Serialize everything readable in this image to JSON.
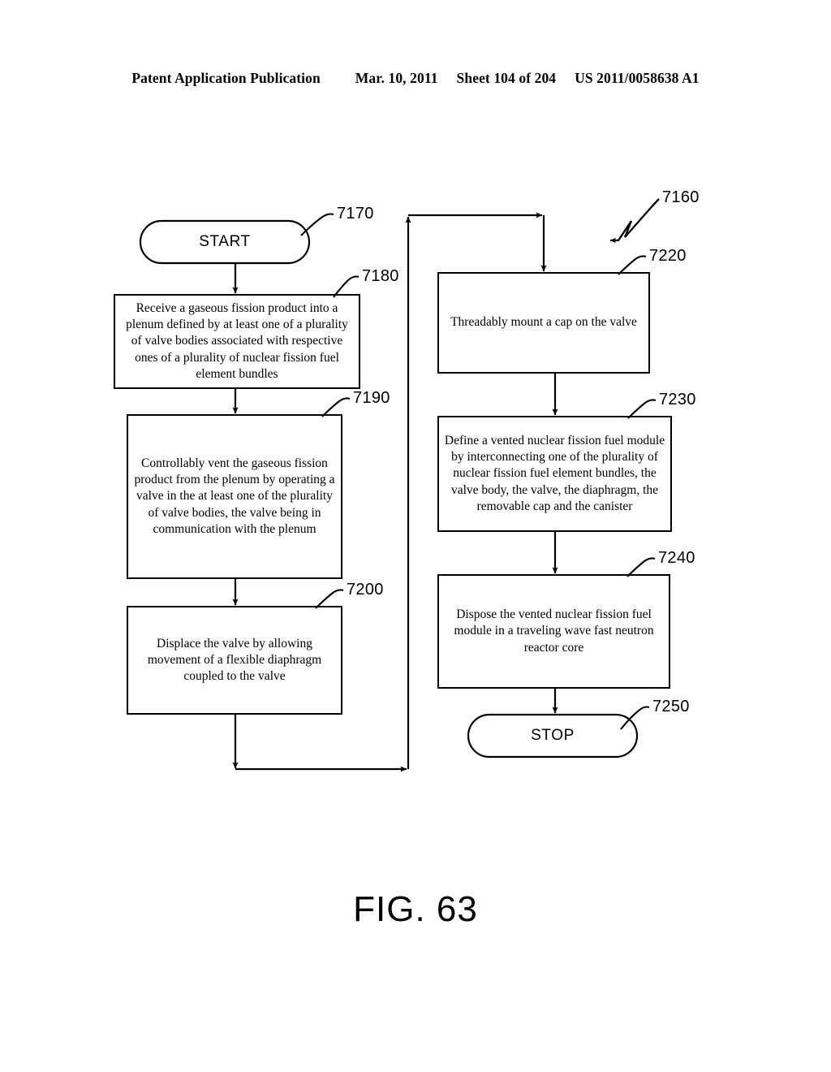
{
  "header": {
    "publication": "Patent Application Publication",
    "date": "Mar. 10, 2011",
    "sheet": "Sheet 104 of 204",
    "patent_number": "US 2011/0058638 A1"
  },
  "figure": {
    "caption": "FIG. 63",
    "diagram_ref": "7160"
  },
  "flowchart": {
    "type": "flowchart",
    "nodes": [
      {
        "id": "start",
        "ref": "7170",
        "shape": "terminal",
        "label": "START",
        "column": "left"
      },
      {
        "id": "step_7180",
        "ref": "7180",
        "shape": "process",
        "label": "Receive a gaseous fission product into a plenum defined by at least one of a plurality of valve bodies associated with respective ones of a plurality of nuclear fission fuel element bundles",
        "column": "left"
      },
      {
        "id": "step_7190",
        "ref": "7190",
        "shape": "process",
        "label": "Controllably vent the gaseous fission product from the plenum by operating a valve in the at least one of the plurality of valve bodies, the valve being in communication with the plenum",
        "column": "left"
      },
      {
        "id": "step_7200",
        "ref": "7200",
        "shape": "process",
        "label": "Displace the valve by allowing movement of a flexible diaphragm coupled to the valve",
        "column": "left"
      },
      {
        "id": "step_7220",
        "ref": "7220",
        "shape": "process",
        "label": "Threadably mount a cap on the valve",
        "column": "right"
      },
      {
        "id": "step_7230",
        "ref": "7230",
        "shape": "process",
        "label": "Define a vented nuclear fission fuel module by interconnecting one of the plurality of nuclear fission fuel element bundles, the valve body, the valve, the diaphragm, the removable cap and the canister",
        "column": "right"
      },
      {
        "id": "step_7240",
        "ref": "7240",
        "shape": "process",
        "label": "Dispose the vented nuclear fission fuel module in a traveling wave fast neutron reactor core",
        "column": "right"
      },
      {
        "id": "stop",
        "ref": "7250",
        "shape": "terminal",
        "label": "STOP",
        "column": "right"
      }
    ],
    "edges": [
      {
        "from": "start",
        "to": "step_7180"
      },
      {
        "from": "step_7180",
        "to": "step_7190"
      },
      {
        "from": "step_7190",
        "to": "step_7200"
      },
      {
        "from": "step_7200",
        "to": "step_7220",
        "routing": "return-loop"
      },
      {
        "from": "step_7220",
        "to": "step_7230"
      },
      {
        "from": "step_7230",
        "to": "step_7240"
      },
      {
        "from": "step_7240",
        "to": "stop"
      }
    ]
  },
  "colors": {
    "ink": "#000000",
    "paper": "#ffffff"
  }
}
